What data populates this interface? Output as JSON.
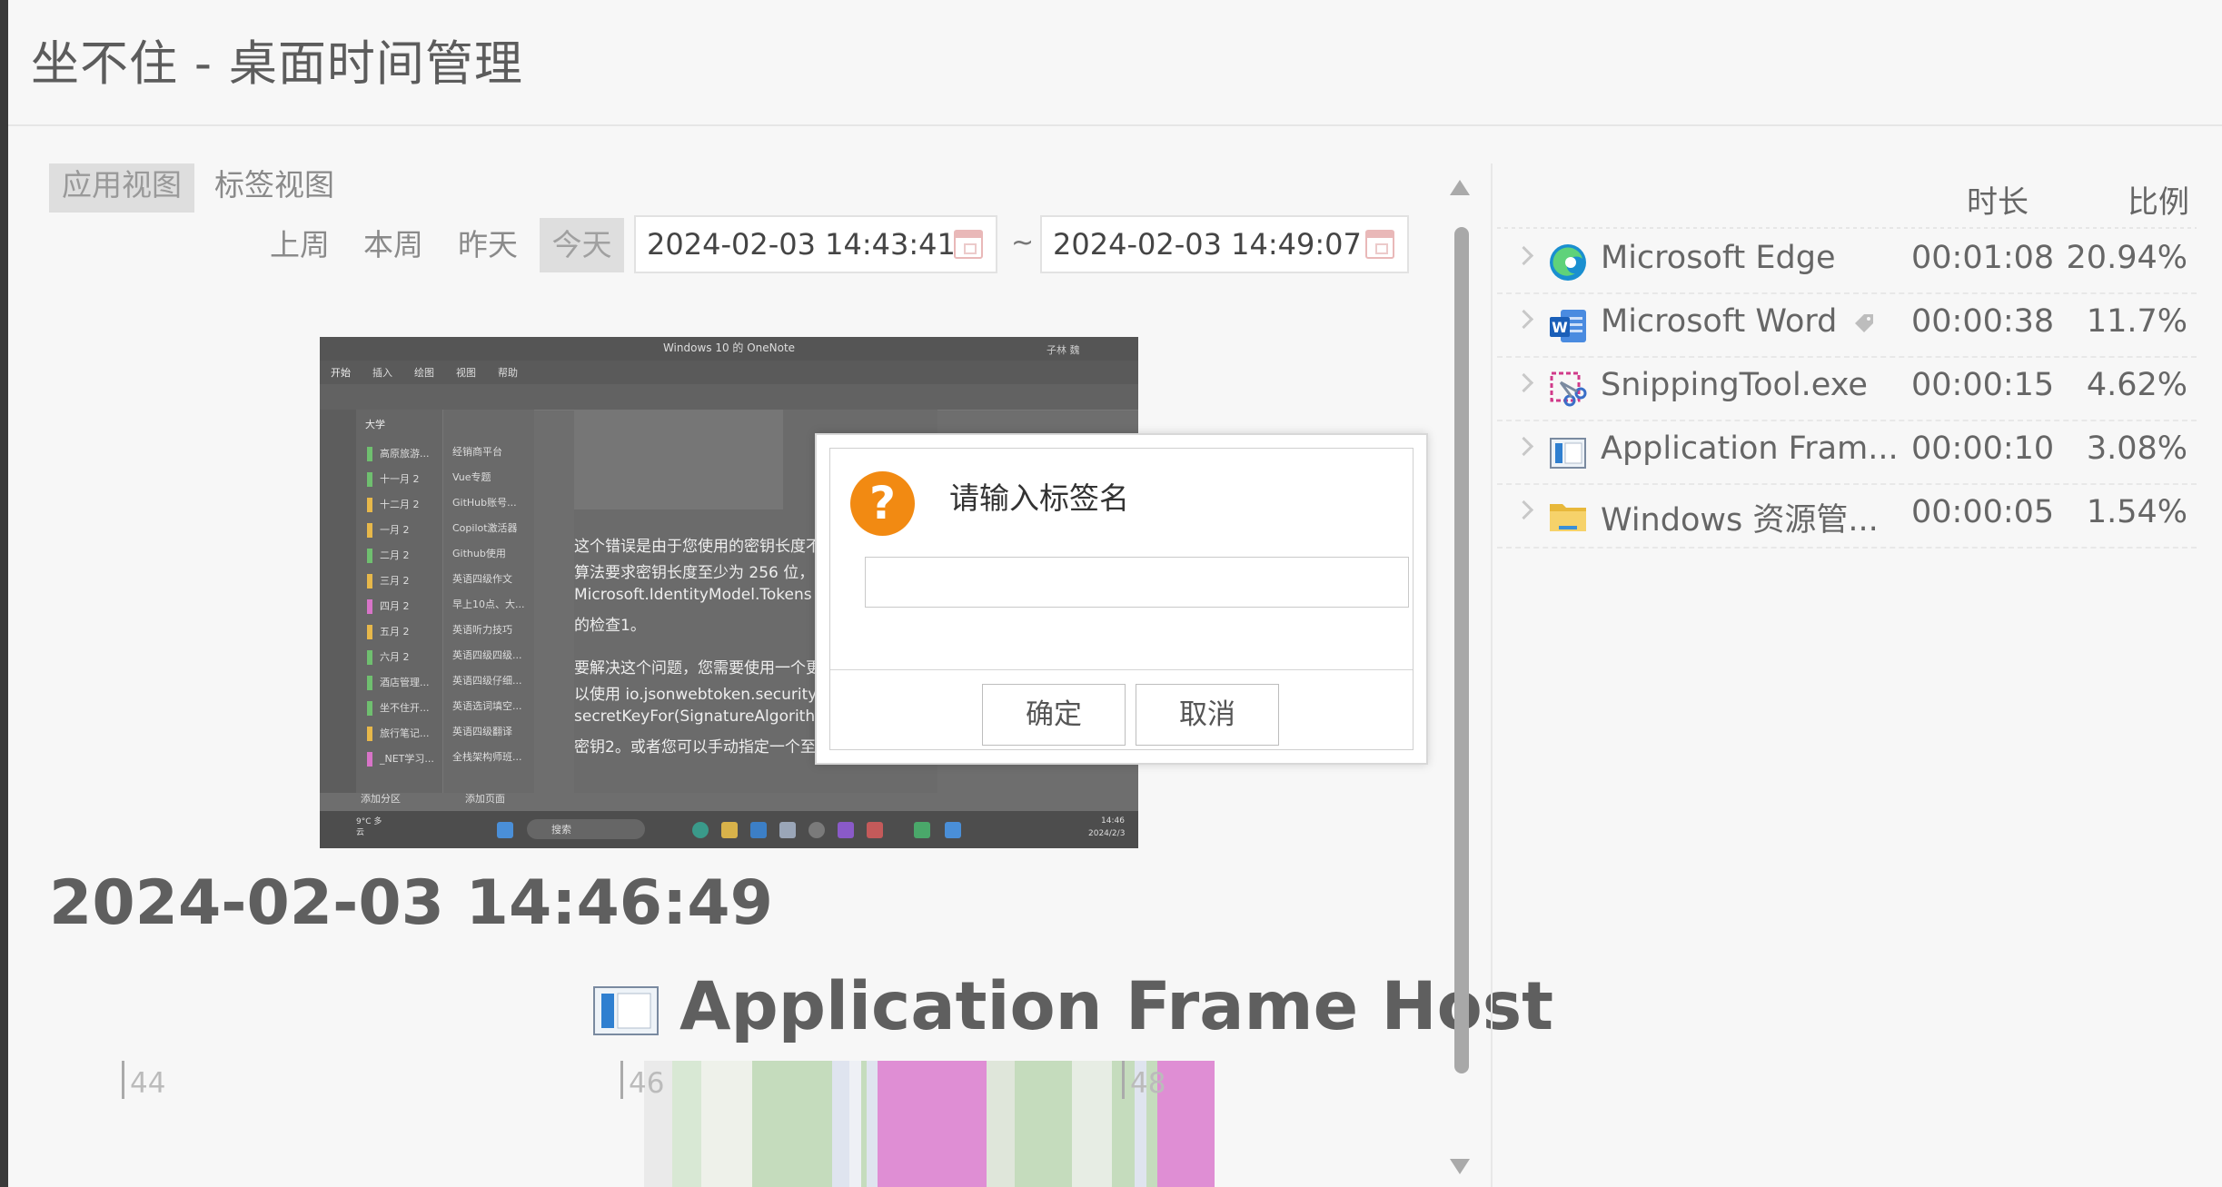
{
  "app": {
    "title": "坐不住 - 桌面时间管理"
  },
  "views": {
    "app_view": "应用视图",
    "tag_view": "标签视图"
  },
  "range": {
    "last_week": "上周",
    "this_week": "本周",
    "yesterday": "昨天",
    "today": "今天",
    "active": "today"
  },
  "filter": {
    "start": "2024-02-03 14:43:41",
    "end": "2024-02-03 14:49:07",
    "separator": "~"
  },
  "snapshot": {
    "window_title": "Windows 10 的 OneNote",
    "user": "子林 魏",
    "ribbon_tabs": [
      "开始",
      "插入",
      "绘图",
      "视图",
      "帮助"
    ],
    "notebook": "大学",
    "sections": [
      {
        "label": "高原旅游...",
        "color": "#6fbf6f"
      },
      {
        "label": "十一月 2",
        "color": "#6fbf6f"
      },
      {
        "label": "十二月 2",
        "color": "#e7b84a"
      },
      {
        "label": "一月 2",
        "color": "#e7b84a"
      },
      {
        "label": "二月 2",
        "color": "#6fbf6f"
      },
      {
        "label": "三月 2",
        "color": "#e7b84a"
      },
      {
        "label": "四月 2",
        "color": "#d874c8"
      },
      {
        "label": "五月 2",
        "color": "#e7b84a"
      },
      {
        "label": "六月 2",
        "color": "#6fbf6f"
      },
      {
        "label": "酒店管理...",
        "color": "#6fbf6f"
      },
      {
        "label": "坐不住开...",
        "color": "#6fbf6f"
      },
      {
        "label": "旅行笔记...",
        "color": "#e7b84a"
      },
      {
        "label": "_NET学习...",
        "color": "#d874c8"
      }
    ],
    "pages": [
      "经销商平台",
      "Vue专题",
      "GitHub账号...",
      "Copilot激活器",
      "Github使用",
      "英语四级作文",
      "早上10点、大...",
      "英语听力技巧",
      "英语四级四级...",
      "英语四级仔细...",
      "英语选词填空...",
      "英语四级翻译",
      "全栈架构师班..."
    ],
    "add_section": "添加分区",
    "add_page": "添加页面",
    "content_lines": [
      "这个错误是由于您使用的密钥长度不",
      "算法要求密钥长度至少为 256 位，",
      "Microsoft.IdentityModel.Tokens",
      "的检查1。",
      "要解决这个问题，您需要使用一个更",
      "以使用 io.jsonwebtoken.security.",
      "secretKeyFor(SignatureAlgorithm",
      "密钥2。或者您可以手动指定一个至"
    ],
    "taskbar_weather": "9°C 多云",
    "taskbar_search": "搜索",
    "taskbar_time": "14:46",
    "taskbar_date": "2024/2/3"
  },
  "dialog": {
    "title": "请输入标签名",
    "input_value": "",
    "ok": "确定",
    "cancel": "取消"
  },
  "current": {
    "timestamp": "2024-02-03 14:46:49",
    "app_name": "Application Frame Host"
  },
  "timeline": {
    "ticks": [
      "44",
      "46",
      "48"
    ],
    "segments": [
      {
        "start": 0.0,
        "end": 0.05,
        "color": "#eaeaea"
      },
      {
        "start": 0.05,
        "end": 0.1,
        "color": "#d8e8d4"
      },
      {
        "start": 0.1,
        "end": 0.19,
        "color": "#eef1ea"
      },
      {
        "start": 0.19,
        "end": 0.33,
        "color": "#c5dcbd"
      },
      {
        "start": 0.33,
        "end": 0.36,
        "color": "#dfe4ef"
      },
      {
        "start": 0.36,
        "end": 0.38,
        "color": "#eef0f5"
      },
      {
        "start": 0.38,
        "end": 0.39,
        "color": "#c5dcbd"
      },
      {
        "start": 0.39,
        "end": 0.41,
        "color": "#dfe4ef"
      },
      {
        "start": 0.41,
        "end": 0.6,
        "color": "#df8ed4"
      },
      {
        "start": 0.6,
        "end": 0.65,
        "color": "#dfe6da"
      },
      {
        "start": 0.65,
        "end": 0.75,
        "color": "#c5dcbd"
      },
      {
        "start": 0.75,
        "end": 0.82,
        "color": "#e7ede4"
      },
      {
        "start": 0.82,
        "end": 0.86,
        "color": "#c5dcbd"
      },
      {
        "start": 0.86,
        "end": 0.88,
        "color": "#dfe4ef"
      },
      {
        "start": 0.88,
        "end": 0.9,
        "color": "#c5dcbd"
      },
      {
        "start": 0.9,
        "end": 1.0,
        "color": "#df8ed4"
      }
    ]
  },
  "summary": {
    "headers": {
      "duration": "时长",
      "ratio": "比例"
    },
    "rows": [
      {
        "name": "Microsoft Edge",
        "duration": "00:01:08",
        "ratio": "20.94%",
        "icon": "edge-icon",
        "tagged": false
      },
      {
        "name": "Microsoft Word",
        "duration": "00:00:38",
        "ratio": "11.7%",
        "icon": "word-icon",
        "tagged": true
      },
      {
        "name": "SnippingTool.exe",
        "duration": "00:00:15",
        "ratio": "4.62%",
        "icon": "snipping-tool-icon",
        "tagged": false
      },
      {
        "name": "Application Fram...",
        "duration": "00:00:10",
        "ratio": "3.08%",
        "icon": "application-frame-icon",
        "tagged": false
      },
      {
        "name": "Windows 资源管...",
        "duration": "00:00:05",
        "ratio": "1.54%",
        "icon": "folder-icon",
        "tagged": false
      }
    ]
  }
}
